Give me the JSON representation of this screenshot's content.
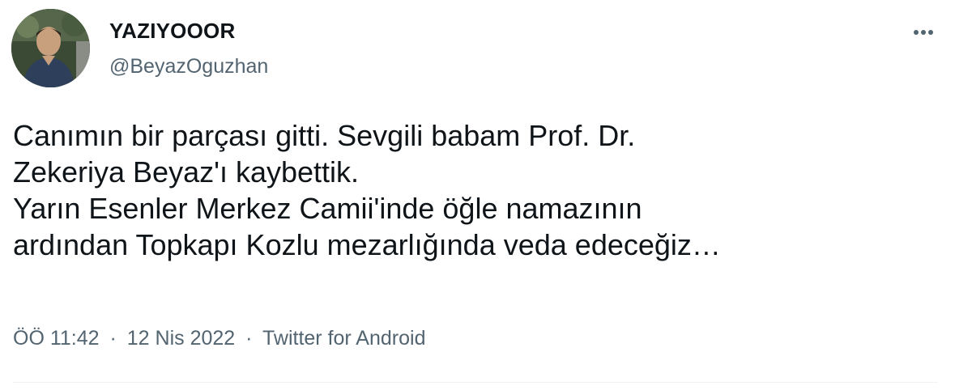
{
  "author": {
    "display_name": "YAZIYOOOR",
    "handle": "@BeyazOguzhan",
    "avatar_icon": "profile-photo-avatar"
  },
  "more_icon": "more-horizontal-icon",
  "tweet": {
    "lines": [
      "Canımın bir parçası gitti. Sevgili babam Prof. Dr.",
      "Zekeriya Beyaz'ı kaybettik.",
      "Yarın Esenler Merkez Camii'inde öğle namazının",
      "ardından Topkapı Kozlu mezarlığında veda edeceğiz…"
    ]
  },
  "meta": {
    "time": "ÖÖ 11:42",
    "separator": "·",
    "date": "12 Nis 2022",
    "source": "Twitter for Android"
  },
  "colors": {
    "text_primary": "#0f1419",
    "text_secondary": "#536471",
    "divider": "#eff3f4"
  }
}
